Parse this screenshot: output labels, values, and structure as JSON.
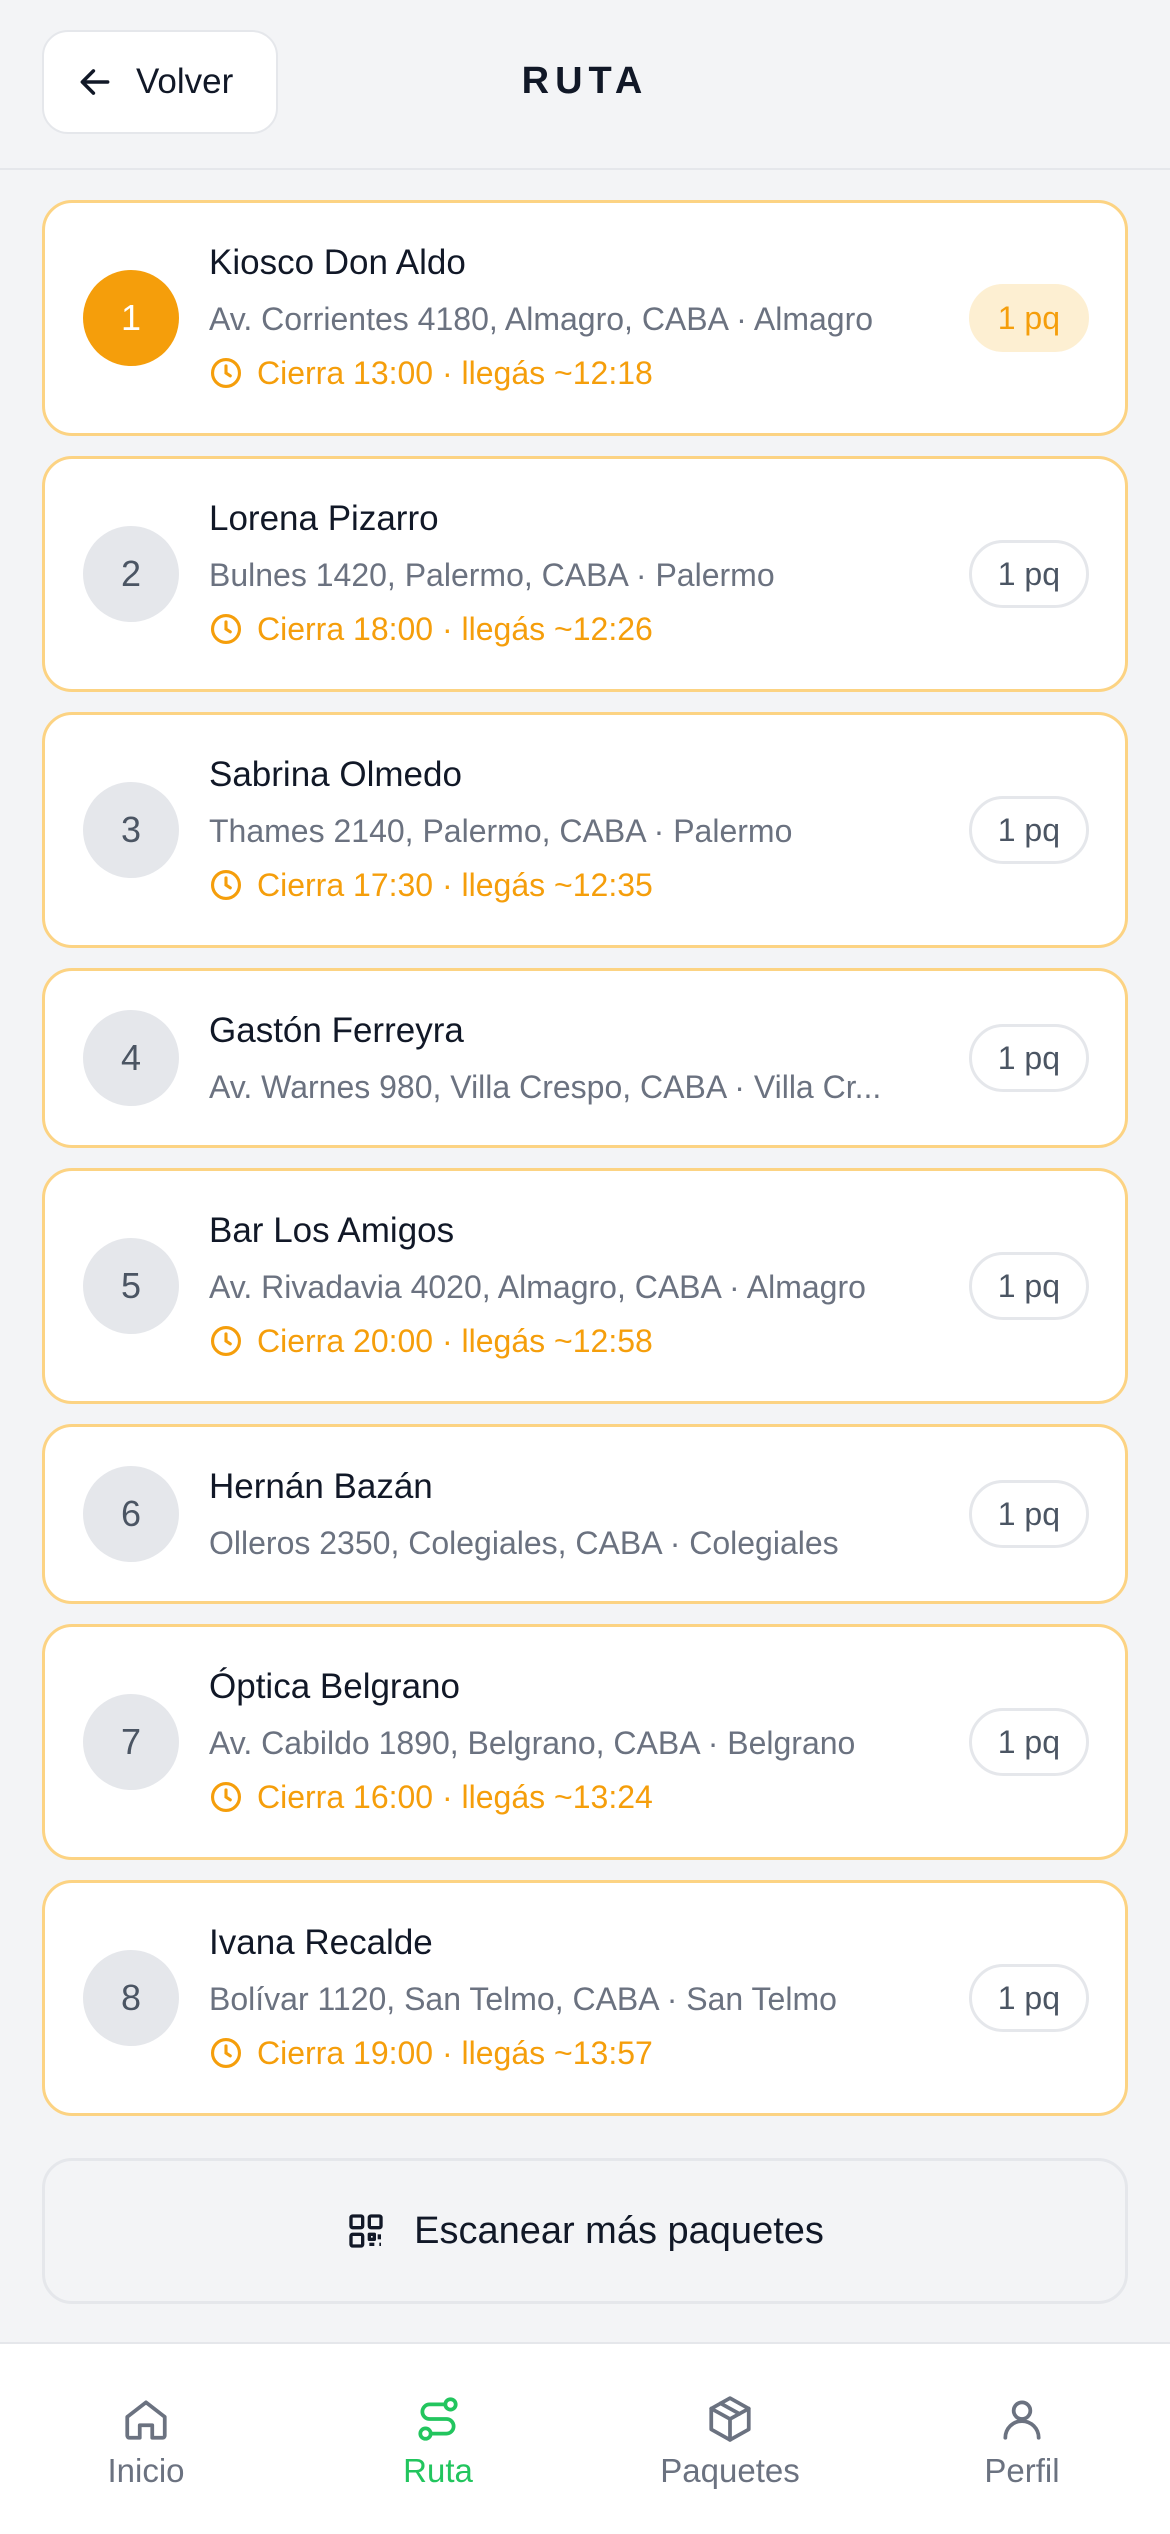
{
  "header": {
    "back_label": "Volver",
    "title": "RUTA"
  },
  "stops": [
    {
      "number": "1",
      "name": "Kiosco Don Aldo",
      "address": "Av. Corrientes 4180, Almagro, CABA · Almagro",
      "closing": "Cierra 13:00 · llegás ~12:18",
      "packages": "1 pq",
      "active": true
    },
    {
      "number": "2",
      "name": "Lorena Pizarro",
      "address": "Bulnes 1420, Palermo, CABA · Palermo",
      "closing": "Cierra 18:00 · llegás ~12:26",
      "packages": "1 pq"
    },
    {
      "number": "3",
      "name": "Sabrina Olmedo",
      "address": "Thames 2140, Palermo, CABA · Palermo",
      "closing": "Cierra 17:30 · llegás ~12:35",
      "packages": "1 pq"
    },
    {
      "number": "4",
      "name": "Gastón Ferreyra",
      "address": "Av. Warnes 980, Villa Crespo, CABA · Villa Cr...",
      "closing": "",
      "packages": "1 pq"
    },
    {
      "number": "5",
      "name": "Bar Los Amigos",
      "address": "Av. Rivadavia 4020, Almagro, CABA · Almagro",
      "closing": "Cierra 20:00 · llegás ~12:58",
      "packages": "1 pq"
    },
    {
      "number": "6",
      "name": "Hernán Bazán",
      "address": "Olleros 2350, Colegiales, CABA · Colegiales",
      "closing": "",
      "packages": "1 pq"
    },
    {
      "number": "7",
      "name": "Óptica Belgrano",
      "address": "Av. Cabildo 1890, Belgrano, CABA · Belgrano",
      "closing": "Cierra 16:00 · llegás ~13:24",
      "packages": "1 pq"
    },
    {
      "number": "8",
      "name": "Ivana Recalde",
      "address": "Bolívar 1120, San Telmo, CABA · San Telmo",
      "closing": "Cierra 19:00 · llegás ~13:57",
      "packages": "1 pq"
    }
  ],
  "scan_button": {
    "label": "Escanear más paquetes",
    "icon": "qr-code-icon"
  },
  "tabs": [
    {
      "label": "Inicio",
      "icon": "home-icon"
    },
    {
      "label": "Ruta",
      "icon": "route-icon",
      "active": true
    },
    {
      "label": "Paquetes",
      "icon": "package-icon"
    },
    {
      "label": "Perfil",
      "icon": "user-icon"
    }
  ],
  "colors": {
    "accent": "#f59e0b",
    "active_tab": "#22c55e",
    "card_border": "#fcd383",
    "background": "#f3f4f6"
  }
}
